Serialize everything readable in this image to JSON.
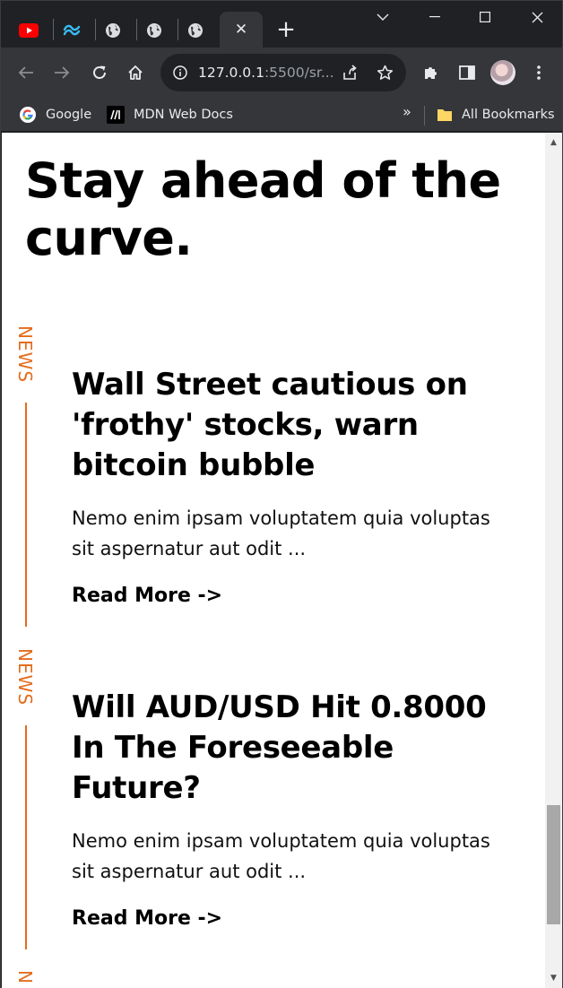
{
  "browser": {
    "tabs": [
      {
        "icon": "youtube-icon"
      },
      {
        "icon": "tailwind-icon"
      },
      {
        "icon": "globe-icon"
      },
      {
        "icon": "globe-icon"
      },
      {
        "icon": "globe-icon"
      }
    ],
    "active_tab_close": "✕",
    "new_tab": "+",
    "address": {
      "host": "127.0.0.1",
      "path": ":5500/sr..."
    },
    "bookmarks": [
      {
        "label": "Google",
        "icon": "google-icon"
      },
      {
        "label": "MDN Web Docs",
        "icon": "mdn-icon"
      }
    ],
    "bookmarks_overflow": "»",
    "all_bookmarks": "All Bookmarks"
  },
  "page": {
    "title": "Stay ahead of the curve.",
    "articles": [
      {
        "tag": "NEWS",
        "headline": "Wall Street cautious on 'frothy' stocks, warn bitcoin bubble",
        "excerpt": "Nemo enim ipsam voluptatem quia voluptas sit aspernatur aut odit ...",
        "link": "Read More ->"
      },
      {
        "tag": "NEWS",
        "headline": "Will AUD/USD Hit 0.8000 In The Foreseeable Future?",
        "excerpt": "Nemo enim ipsam voluptatem quia voluptas sit aspernatur aut odit ...",
        "link": "Read More ->"
      },
      {
        "tag": "N"
      }
    ]
  },
  "colors": {
    "accent": "#e46d1c",
    "chrome_dark": "#202124",
    "toolbar": "#35363a"
  }
}
